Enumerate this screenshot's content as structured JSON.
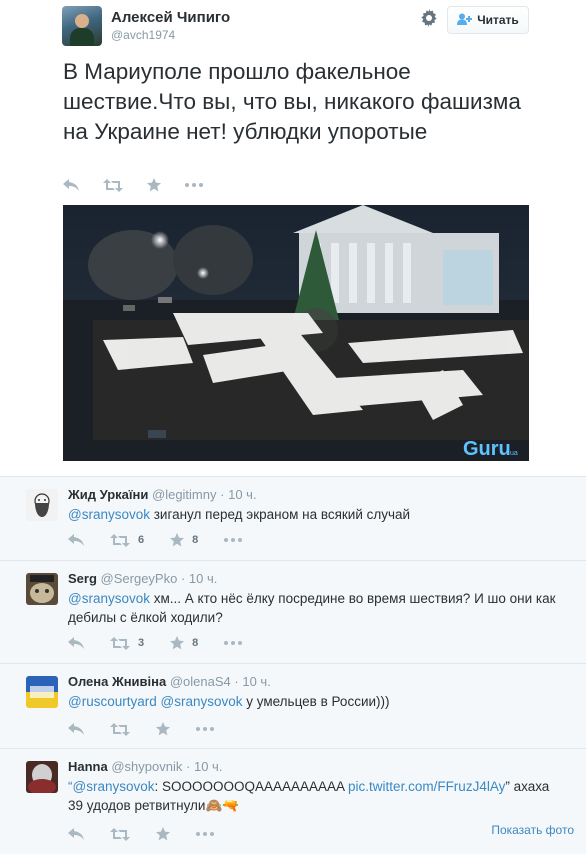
{
  "tweet": {
    "fullname": "Алексей Чипиго",
    "username": "@avch1974",
    "follow_label": "Читать",
    "text": "В Мариуполе прошло факельное шествие.Что вы, что вы, никакого фашизма на Украине нет! ублюдки упоротые",
    "photo_watermark": "Guru",
    "photo_watermark_small": "ua",
    "photo_caption_faint": "ukraina.guru.ua"
  },
  "replies": [
    {
      "name": "Жид Уркаїни",
      "username": "@legitimny",
      "dot": "·",
      "time": "10 ч.",
      "mention1": "@sranysovok",
      "text": " зиганул перед экраном на всякий случай",
      "retweets": "6",
      "favorites": "8"
    },
    {
      "name": "Serg",
      "username": "@SergeyPko",
      "dot": "·",
      "time": "10 ч.",
      "mention1": "@sranysovok",
      "text": " хм... А кто нёс ёлку посредине во время шествия? И шо они как дебилы с ёлкой ходили?",
      "retweets": "3",
      "favorites": "8"
    },
    {
      "name": "Олена Жнивіна",
      "username": "@olenaS4",
      "dot": "·",
      "time": "10 ч.",
      "mention1": "@ruscourtyard",
      "mention2": "@sranysovok",
      "text": " у умельцев в России)))",
      "retweets": "",
      "favorites": ""
    },
    {
      "name": "Hanna",
      "username": "@shypovnik",
      "dot": "·",
      "time": "10 ч.",
      "quote_open": "“",
      "mention1": "@sranysovok",
      "text_a": ": SOOOOOOOQAAAAAAAAAA ",
      "link": "pic.twitter.com/FFruzJ4lAy",
      "text_b": "” ахаха 39 удодов ретвитнули",
      "emoji": "🙈🔫",
      "show_photo": "Показать фото"
    }
  ],
  "icons": [
    "gear-icon",
    "follow-plus-icon",
    "reply-icon",
    "retweet-icon",
    "favorite-icon",
    "more-icon"
  ],
  "colors": {
    "accent": "#3b88c3",
    "muted": "#8899a6",
    "icon": "#aab8c2",
    "reply_bg": "#f5f8fa"
  }
}
